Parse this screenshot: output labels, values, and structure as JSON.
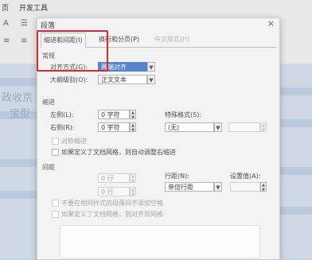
{
  "ribbon": {
    "tabs": [
      "页",
      "开发工具"
    ]
  },
  "document": {
    "fragments": [
      "政收京",
      "宝型"
    ]
  },
  "dialog": {
    "title": "段落",
    "close": "×",
    "tabs": [
      "缩进和间距(I)",
      "换行和分页(P)",
      "中文版式(H)"
    ],
    "general_section": "常规",
    "alignment_label": "对齐方式(G):",
    "alignment_value": "两端对齐",
    "outline_label": "大纲级别(O):",
    "outline_value": "正文文本",
    "indent_section": "缩进",
    "left_label": "左侧(L):",
    "left_value": "0 字符",
    "right_label": "右侧(R):",
    "right_value": "0 字符",
    "special_label": "特殊格式(S):",
    "special_value": "(无)",
    "mirror_indent": "对称缩进",
    "auto_adjust": "如果定义了文档网格，则自动调整右缩进",
    "spacing_section": "间距",
    "before_value": "0 行",
    "after_value": "0 行",
    "line_spacing_label": "行距(N):",
    "line_spacing_value": "单倍行距",
    "set_value_label": "设置值(A):",
    "no_space_same_style": "不要在相同样式的段落间不添加空格",
    "snap_to_grid": "如果定义了文档网格，则对齐到网格"
  }
}
